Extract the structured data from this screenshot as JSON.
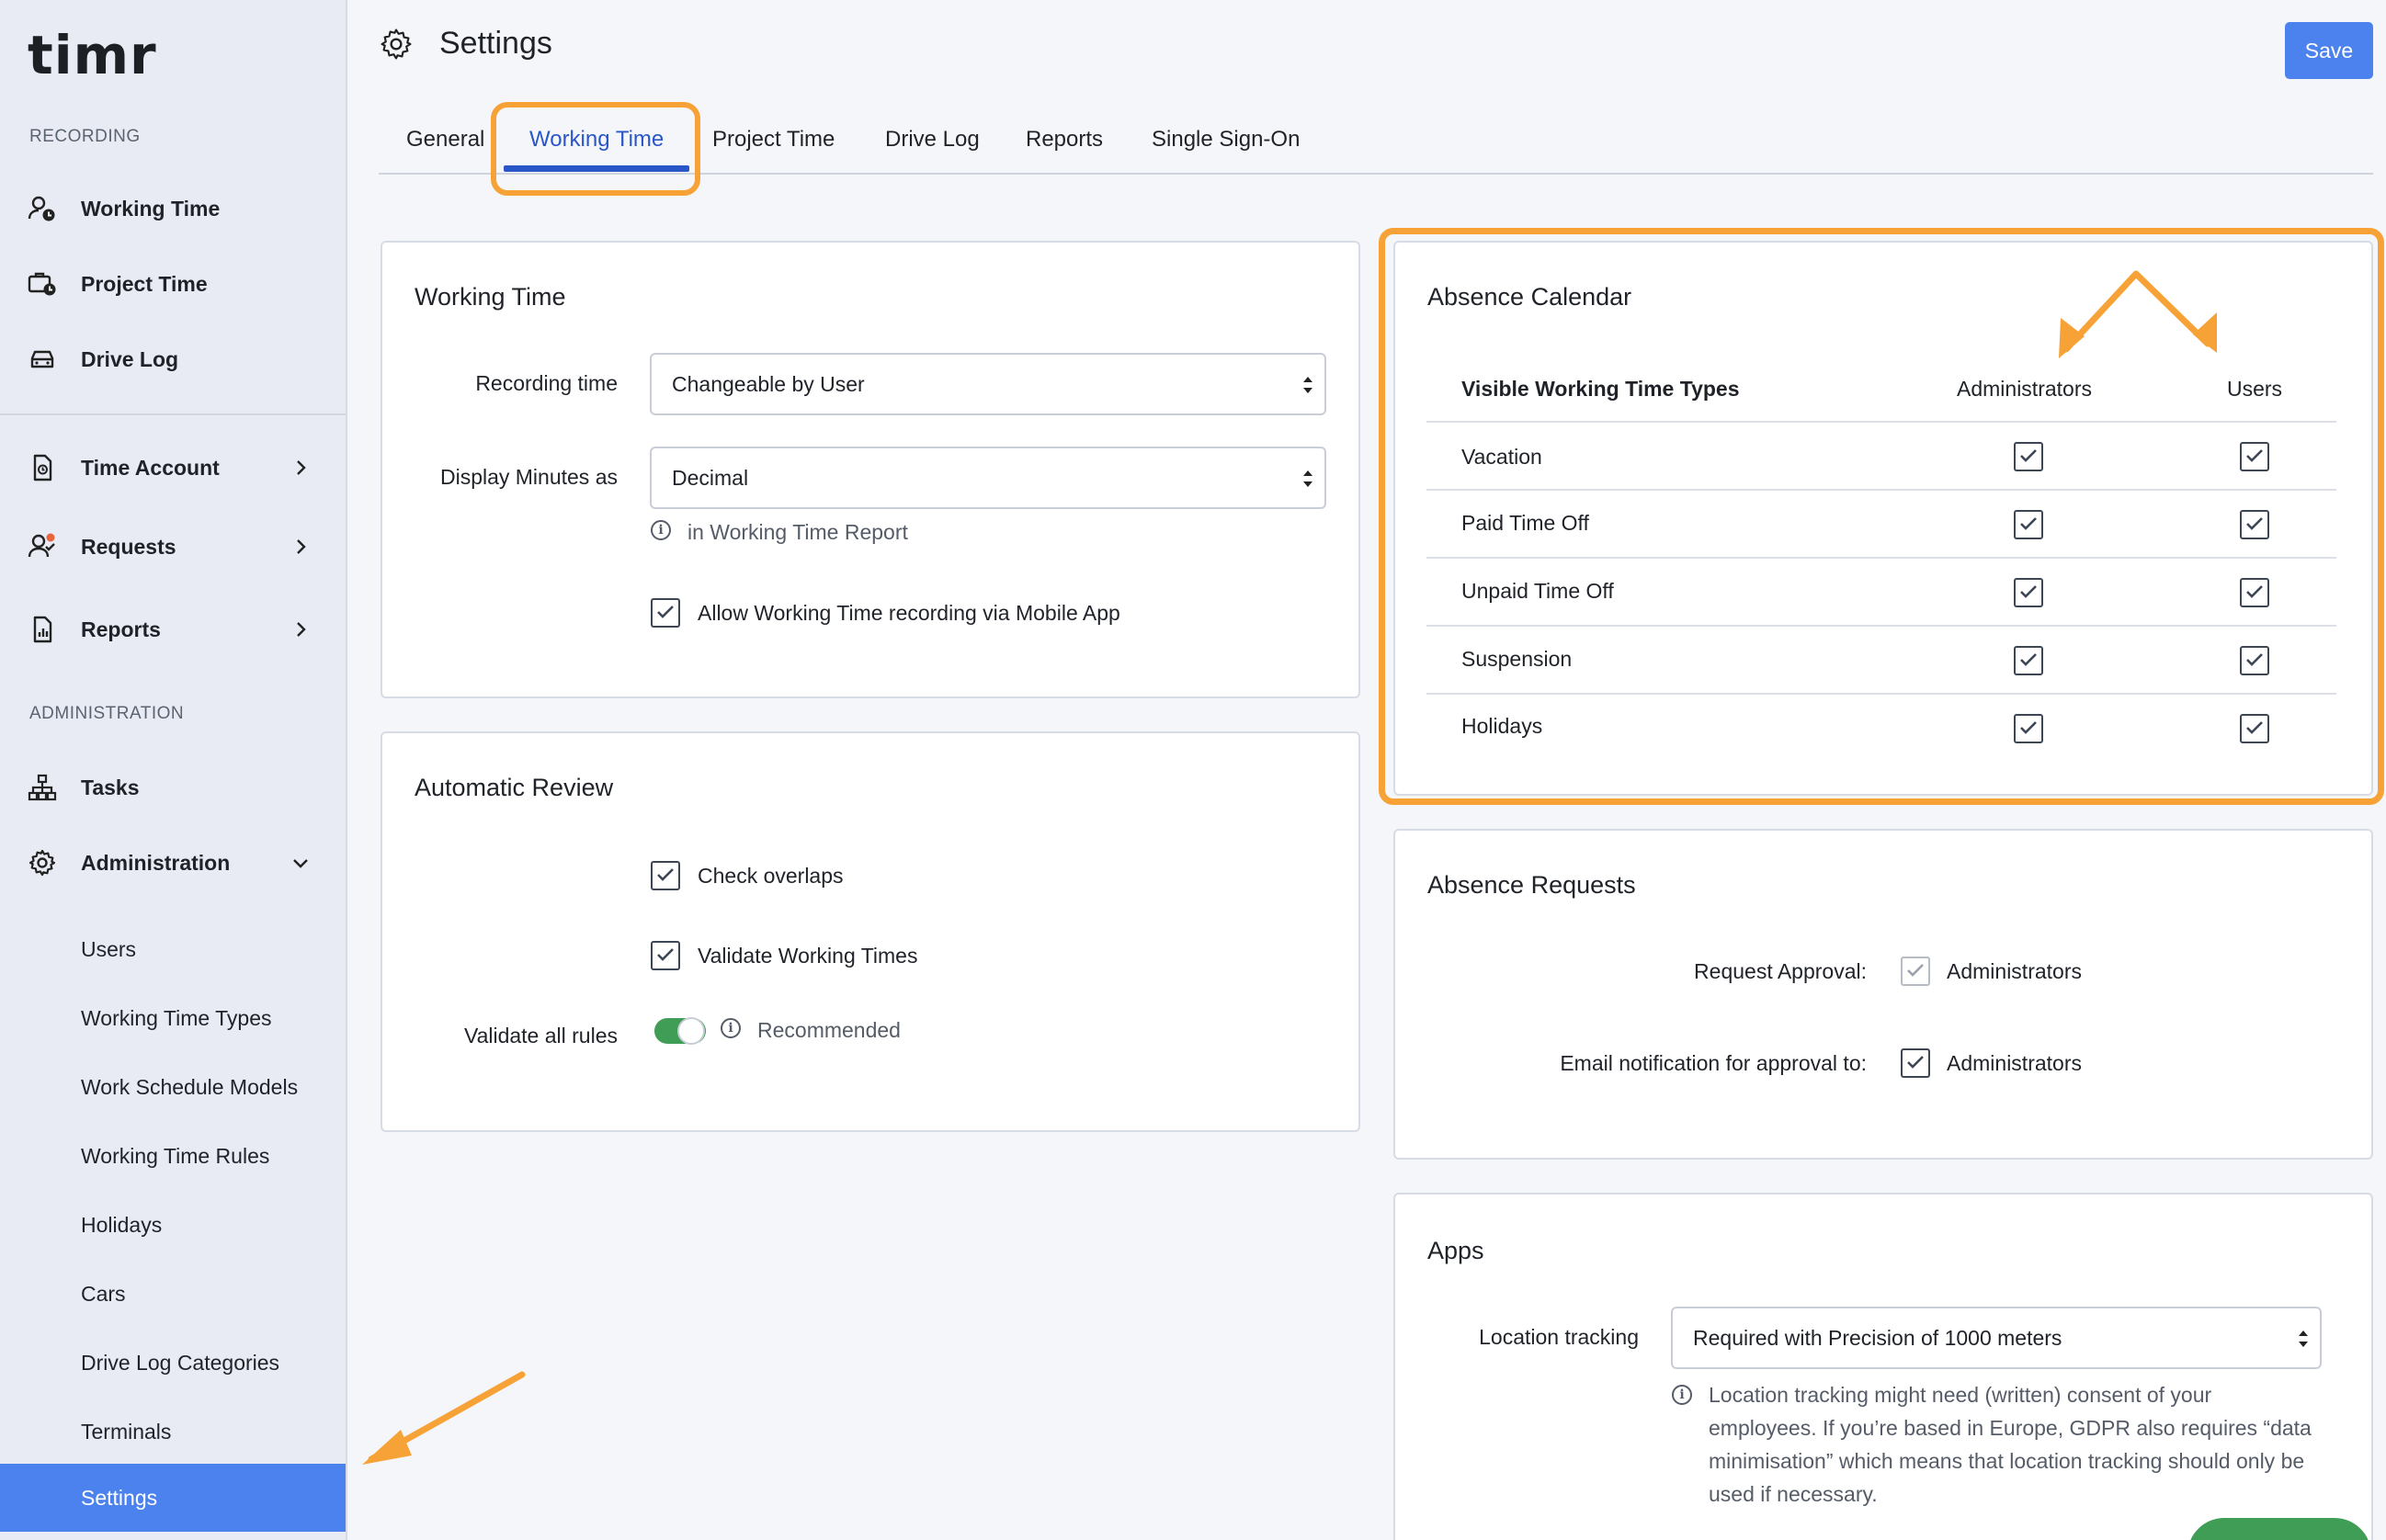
{
  "app": {
    "logo": "timr"
  },
  "sidebar": {
    "recording_label": "RECORDING",
    "recording_items": [
      {
        "label": "Working Time",
        "icon": "user-clock-icon"
      },
      {
        "label": "Project Time",
        "icon": "briefcase-clock-icon"
      },
      {
        "label": "Drive Log",
        "icon": "car-icon"
      }
    ],
    "account_items": [
      {
        "label": "Time Account",
        "icon": "document-clock-icon"
      },
      {
        "label": "Requests",
        "icon": "user-check-icon"
      },
      {
        "label": "Reports",
        "icon": "report-icon"
      }
    ],
    "administration_label": "ADMINISTRATION",
    "admin_items": [
      {
        "label": "Tasks",
        "icon": "hierarchy-icon"
      },
      {
        "label": "Administration",
        "icon": "gear-icon"
      }
    ],
    "sub_items": [
      "Users",
      "Working Time Types",
      "Work Schedule Models",
      "Working Time Rules",
      "Holidays",
      "Cars",
      "Drive Log Categories",
      "Terminals",
      "Settings"
    ]
  },
  "header": {
    "title": "Settings",
    "save_label": "Save"
  },
  "tabs": [
    "General",
    "Working Time",
    "Project Time",
    "Drive Log",
    "Reports",
    "Single Sign-On"
  ],
  "working_time": {
    "title": "Working Time",
    "recording_time_label": "Recording time",
    "recording_time_value": "Changeable by User",
    "display_minutes_label": "Display Minutes as",
    "display_minutes_value": "Decimal",
    "display_hint": "in Working Time Report",
    "mobile_app_label": "Allow Working Time recording via Mobile App"
  },
  "automatic_review": {
    "title": "Automatic Review",
    "check_overlaps": "Check overlaps",
    "validate_times": "Validate Working Times",
    "validate_all_label": "Validate all rules",
    "recommended": "Recommended"
  },
  "absence_calendar": {
    "title": "Absence Calendar",
    "col_types": "Visible Working Time Types",
    "col_admins": "Administrators",
    "col_users": "Users",
    "rows": [
      "Vacation",
      "Paid Time Off",
      "Unpaid Time Off",
      "Suspension",
      "Holidays"
    ]
  },
  "absence_requests": {
    "title": "Absence Requests",
    "request_approval_label": "Request Approval:",
    "request_approval_value": "Administrators",
    "email_label": "Email notification for approval to:",
    "email_value": "Administrators"
  },
  "apps": {
    "title": "Apps",
    "location_label": "Location tracking",
    "location_value": "Required with Precision of 1000 meters",
    "location_hint": "Location tracking might need (written) consent of your employees. If you’re based in Europe, GDPR also requires “data minimisation” which means that location tracking should only be used if necessary."
  },
  "colors": {
    "accent": "#4c82ee",
    "highlight": "#f7a237",
    "toggle": "#3f9d55",
    "tab_active": "#2a57c8"
  }
}
